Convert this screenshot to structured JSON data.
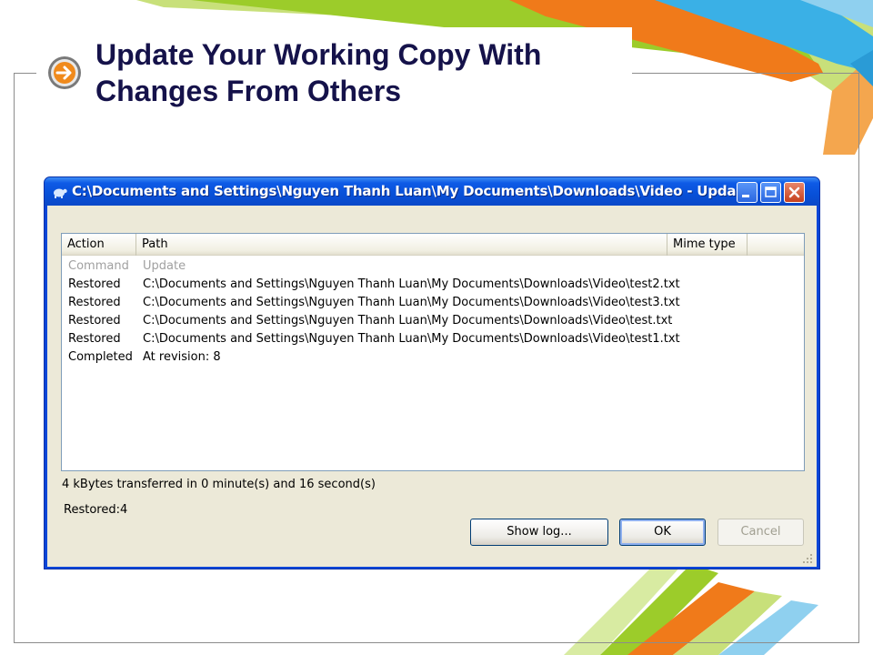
{
  "slide": {
    "title": "Update Your Working Copy With Changes From Others"
  },
  "window": {
    "title": "C:\\Documents and Settings\\Nguyen Thanh Luan\\My Documents\\Downloads\\Video - Upda...",
    "minimize_icon": "minimize-icon",
    "maximize_icon": "maximize-icon",
    "close_icon": "close-icon"
  },
  "list": {
    "columns": [
      "Action",
      "Path",
      "Mime type"
    ],
    "rows": [
      {
        "action": "Command",
        "path": "Update",
        "dim": true
      },
      {
        "action": "Restored",
        "path": "C:\\Documents and Settings\\Nguyen Thanh Luan\\My Documents\\Downloads\\Video\\test2.txt"
      },
      {
        "action": "Restored",
        "path": "C:\\Documents and Settings\\Nguyen Thanh Luan\\My Documents\\Downloads\\Video\\test3.txt"
      },
      {
        "action": "Restored",
        "path": "C:\\Documents and Settings\\Nguyen Thanh Luan\\My Documents\\Downloads\\Video\\test.txt"
      },
      {
        "action": "Restored",
        "path": "C:\\Documents and Settings\\Nguyen Thanh Luan\\My Documents\\Downloads\\Video\\test1.txt"
      },
      {
        "action": "Completed",
        "path": "At revision: 8"
      }
    ]
  },
  "status": {
    "transfer": "4 kBytes transferred in 0 minute(s) and 16 second(s)",
    "summary": "Restored:4"
  },
  "buttons": {
    "show_log": "Show log...",
    "ok": "OK",
    "cancel": "Cancel"
  },
  "colors": {
    "title_text": "#15124a",
    "xp_title_blue": "#0a46d8",
    "dialog_face": "#ece9d8",
    "accent_orange": "#f07a1a",
    "accent_green": "#9ccc2a",
    "accent_blue": "#3ab0e6"
  }
}
